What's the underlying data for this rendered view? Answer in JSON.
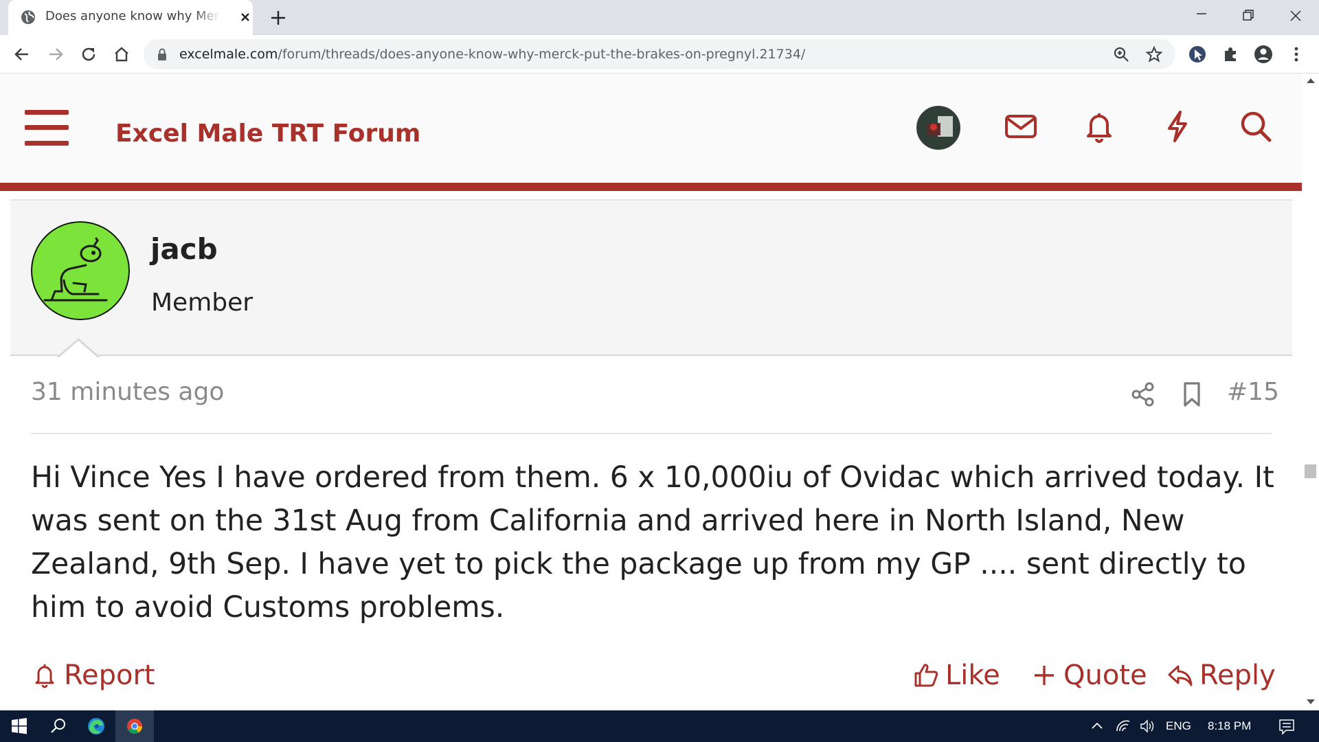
{
  "browser": {
    "tab_title": "Does anyone know why Merck put the brakes on Pregnyl?",
    "url_domain": "excelmale.com",
    "url_path": "/forum/threads/does-anyone-know-why-merck-put-the-brakes-on-pregnyl.21734/"
  },
  "site": {
    "title": "Excel Male TRT Forum",
    "accent_color": "#a8312b",
    "header_icons": [
      "avatar",
      "mail-icon",
      "bell-icon",
      "lightning-icon",
      "search-icon"
    ]
  },
  "post": {
    "username": "jacb",
    "user_title": "Member",
    "time": "31 minutes ago",
    "number": "#15",
    "body": "Hi Vince Yes I have ordered from them. 6 x 10,000iu of Ovidac which arrived today. It was sent on the 31st Aug from California and arrived here in North Island, New Zealand, 9th Sep. I have yet to pick the package up from my GP .... sent directly to him to avoid Customs problems.",
    "actions": {
      "report": "Report",
      "like": "Like",
      "quote": "Quote",
      "reply": "Reply"
    }
  },
  "taskbar": {
    "language": "ENG",
    "time": "8:18 PM"
  }
}
